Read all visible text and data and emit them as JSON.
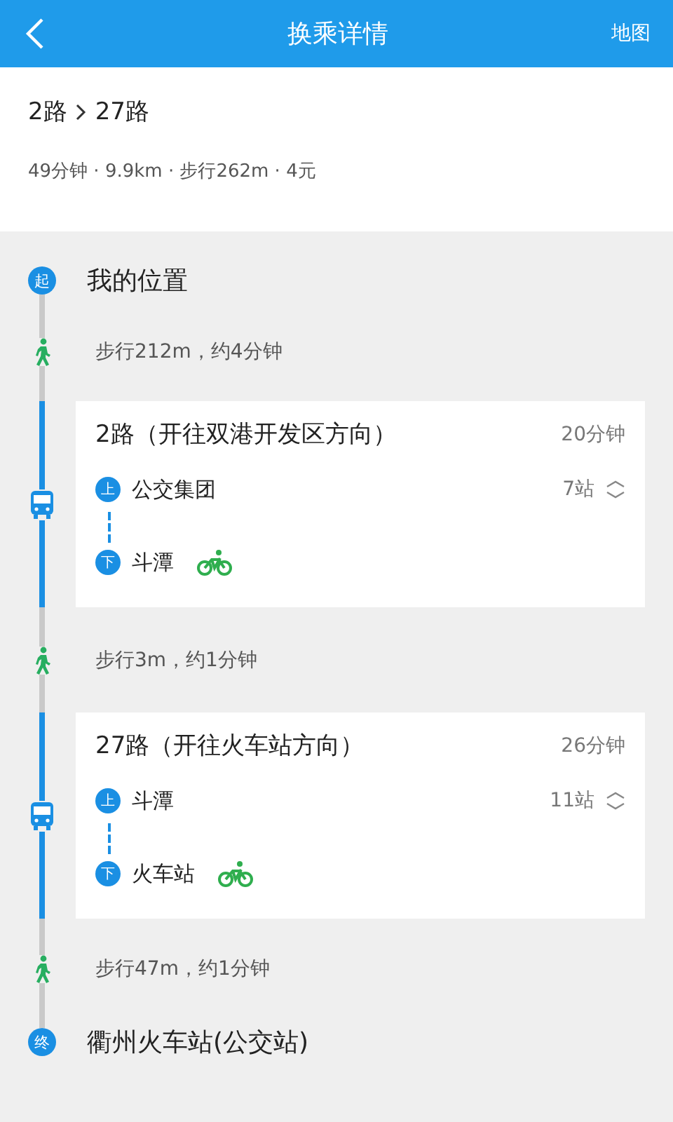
{
  "header": {
    "title": "换乘详情",
    "action": "地图"
  },
  "summary": {
    "routes": [
      "2路",
      "27路"
    ],
    "info": "49分钟 · 9.9km · 步行262m · 4元"
  },
  "steps": [
    {
      "kind": "endpoint",
      "marker": "起",
      "name": "我的位置"
    },
    {
      "kind": "walk",
      "text": "步行212m，约4分钟"
    },
    {
      "kind": "bus",
      "line": "2路（开往双港开发区方向）",
      "duration": "20分钟",
      "board": {
        "marker": "上",
        "name": "公交集团"
      },
      "stops": "7站",
      "alight": {
        "marker": "下",
        "name": "斗潭"
      }
    },
    {
      "kind": "walk",
      "text": "步行3m，约1分钟"
    },
    {
      "kind": "bus",
      "line": "27路（开往火车站方向）",
      "duration": "26分钟",
      "board": {
        "marker": "上",
        "name": "斗潭"
      },
      "stops": "11站",
      "alight": {
        "marker": "下",
        "name": "火车站"
      }
    },
    {
      "kind": "walk",
      "text": "步行47m，约1分钟"
    },
    {
      "kind": "endpoint",
      "marker": "终",
      "name": "衢州火车站(公交站)"
    }
  ]
}
